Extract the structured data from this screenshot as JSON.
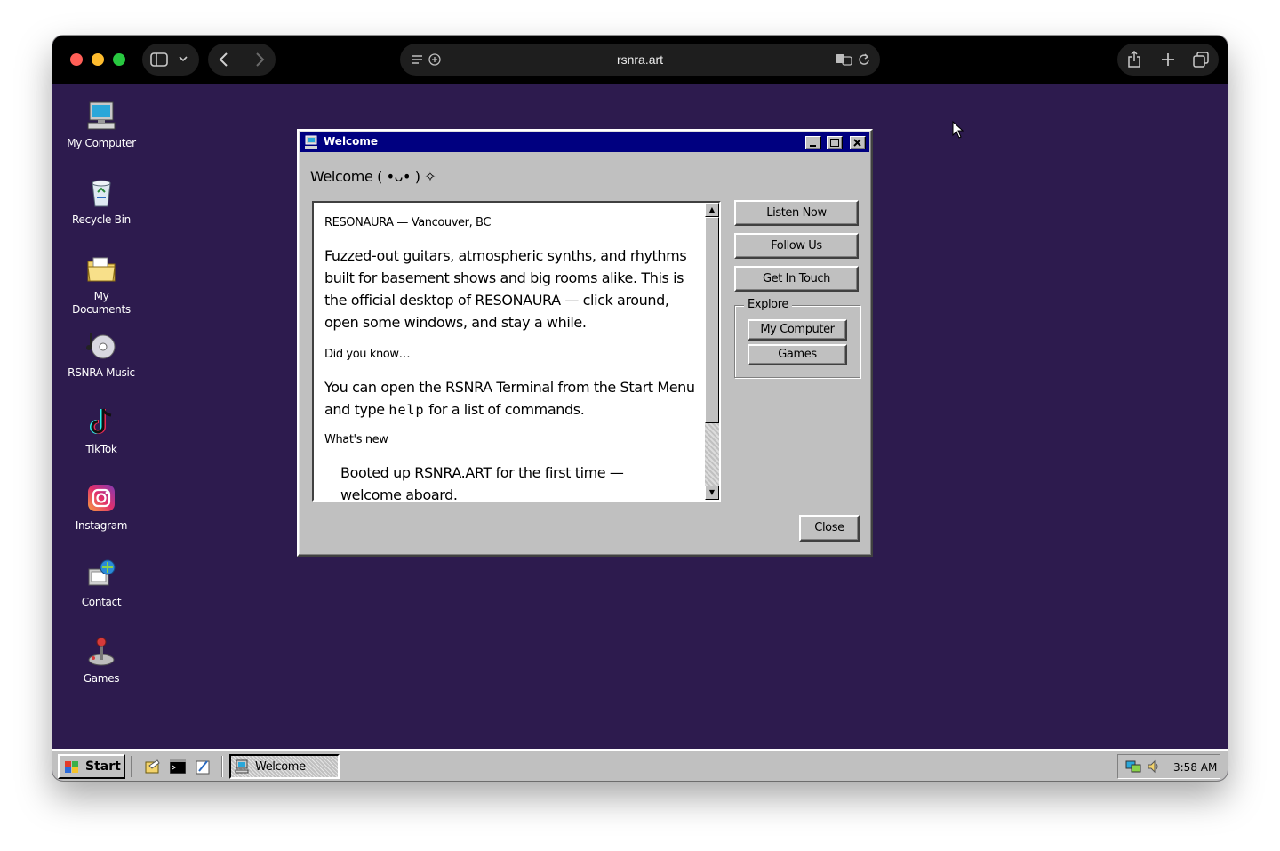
{
  "browser": {
    "url": "rsnra.art"
  },
  "desktop": {
    "icons": [
      {
        "label": "My Computer",
        "icon": "computer-icon"
      },
      {
        "label": "Recycle Bin",
        "icon": "recycle-bin-icon"
      },
      {
        "label": "My Documents",
        "icon": "folder-icon"
      },
      {
        "label": "RSNRA Music",
        "icon": "music-cd-icon"
      },
      {
        "label": "TikTok",
        "icon": "tiktok-icon"
      },
      {
        "label": "Instagram",
        "icon": "instagram-icon"
      },
      {
        "label": "Contact",
        "icon": "contact-icon"
      },
      {
        "label": "Games",
        "icon": "joystick-icon"
      }
    ]
  },
  "window": {
    "title": "Welcome",
    "heading": "Welcome ( •ᴗ• ) ✧",
    "content": {
      "location": "RESONAURA — Vancouver, BC",
      "intro": "Fuzzed-out guitars, atmospheric synths, and rhythms built for basement shows and big rooms alike. This is the official desktop of RESONAURA — click around, open some windows, and stay a while.",
      "did_you_know_label": "Did you know…",
      "tip_prefix": "You can open the RSNRA Terminal from the Start Menu and type ",
      "tip_command": "help",
      "tip_suffix": " for a list of commands.",
      "whats_new_label": "What's new",
      "news_item": "Booted up RSNRA.ART for the first time — welcome aboard."
    },
    "buttons": {
      "listen": "Listen Now",
      "follow": "Follow Us",
      "contact": "Get In Touch",
      "close": "Close"
    },
    "explore": {
      "legend": "Explore",
      "my_computer": "My Computer",
      "games": "Games"
    }
  },
  "taskbar": {
    "start_label": "Start",
    "task_label": "Welcome",
    "clock": "3:58 AM"
  },
  "colors": {
    "desktop_bg": "#2d1b4e",
    "title_bar": "#000080",
    "window_face": "#c0c0c0"
  }
}
